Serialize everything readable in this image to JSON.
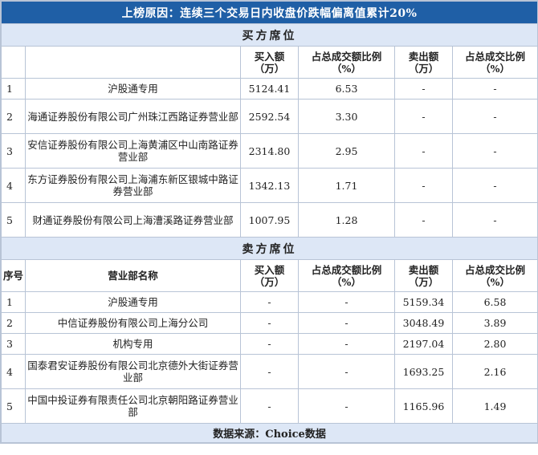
{
  "title": "上榜原因：连续三个交易日内收盘价跌幅偏离值累计20%",
  "buy": {
    "section_title": "买方席位",
    "headers": {
      "idx": "",
      "name": "",
      "buy": "买入额（万）",
      "buy_ratio": "占总成交额比例（%）",
      "sell": "卖出额（万）",
      "sell_ratio": "占总成交比例（%）"
    },
    "rows": [
      {
        "idx": "1",
        "name": "沪股通专用",
        "buy": "5124.41",
        "buy_ratio": "6.53",
        "sell": "-",
        "sell_ratio": "-"
      },
      {
        "idx": "2",
        "name": "海通证券股份有限公司广州珠江西路证券营业部",
        "buy": "2592.54",
        "buy_ratio": "3.30",
        "sell": "-",
        "sell_ratio": "-"
      },
      {
        "idx": "3",
        "name": "安信证券股份有限公司上海黄浦区中山南路证券营业部",
        "buy": "2314.80",
        "buy_ratio": "2.95",
        "sell": "-",
        "sell_ratio": "-"
      },
      {
        "idx": "4",
        "name": "东方证券股份有限公司上海浦东新区银城中路证券营业部",
        "buy": "1342.13",
        "buy_ratio": "1.71",
        "sell": "-",
        "sell_ratio": "-"
      },
      {
        "idx": "5",
        "name": "财通证券股份有限公司上海漕溪路证券营业部",
        "buy": "1007.95",
        "buy_ratio": "1.28",
        "sell": "-",
        "sell_ratio": "-"
      }
    ]
  },
  "sell": {
    "section_title": "卖方席位",
    "headers": {
      "idx": "序号",
      "name": "营业部名称",
      "buy": "买入额（万）",
      "buy_ratio": "占总成交额比例（%）",
      "sell": "卖出额（万）",
      "sell_ratio": "占总成交比例（%）"
    },
    "rows": [
      {
        "idx": "1",
        "name": "沪股通专用",
        "buy": "-",
        "buy_ratio": "-",
        "sell": "5159.34",
        "sell_ratio": "6.58"
      },
      {
        "idx": "2",
        "name": "中信证券股份有限公司上海分公司",
        "buy": "-",
        "buy_ratio": "-",
        "sell": "3048.49",
        "sell_ratio": "3.89"
      },
      {
        "idx": "3",
        "name": "机构专用",
        "buy": "-",
        "buy_ratio": "-",
        "sell": "2197.04",
        "sell_ratio": "2.80"
      },
      {
        "idx": "4",
        "name": "国泰君安证券股份有限公司北京德外大街证券营业部",
        "buy": "-",
        "buy_ratio": "-",
        "sell": "1693.25",
        "sell_ratio": "2.16"
      },
      {
        "idx": "5",
        "name": "中国中投证券有限责任公司北京朝阳路证券营业部",
        "buy": "-",
        "buy_ratio": "-",
        "sell": "1165.96",
        "sell_ratio": "1.49"
      }
    ]
  },
  "footer": "数据来源：Choice数据"
}
